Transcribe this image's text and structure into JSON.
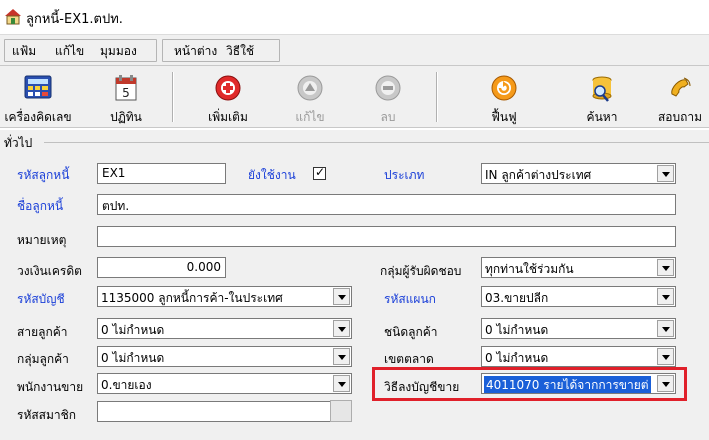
{
  "window": {
    "title": "ลูกหนี้-EX1.ตปท."
  },
  "menu": {
    "group1": [
      "แฟ้ม",
      "แก้ไข",
      "มุมมอง"
    ],
    "group2": [
      "หน้าต่าง",
      "วิธีใช้"
    ]
  },
  "toolbar": {
    "calculator": "เครื่องคิดเลข",
    "calendar": "ปฏิทิน",
    "calendar_day": "5",
    "add": "เพิ่มเติม",
    "edit": "แก้ไข",
    "delete": "ลบ",
    "restore": "ฟื้นฟู",
    "search": "ค้นหา",
    "inquiry": "สอบถาม"
  },
  "section": {
    "label": "ทั่วไป"
  },
  "form": {
    "customer_code_label": "รหัสลูกหนี้",
    "customer_code_value": "EX1",
    "active_label": "ยังใช้งาน",
    "active_mark": "✓",
    "type_label": "ประเภท",
    "type_value": "IN ลูกค้าต่างประเทศ",
    "customer_name_label": "ชื่อลูกหนี้",
    "customer_name_value": "ตปท.",
    "note_label": "หมายเหตุ",
    "note_value": "",
    "credit_limit_label": "วงเงินเครดิต",
    "credit_limit_value": "0.000",
    "responsible_group_label": "กลุ่มผู้รับผิดชอบ",
    "responsible_group_value": "ทุกท่านใช้ร่วมกัน",
    "account_code_label": "รหัสบัญชี",
    "account_code_value": "1135000 ลูกหนี้การค้า-ในประเทศ",
    "department_code_label": "รหัสแผนก",
    "department_code_value": "03.ขายปลีก",
    "customer_line_label": "สายลูกค้า",
    "customer_line_value": "0 ไม่กำหนด",
    "customer_kind_label": "ชนิดลูกค้า",
    "customer_kind_value": "0 ไม่กำหนด",
    "customer_group_label": "กลุ่มลูกค้า",
    "customer_group_value": "0 ไม่กำหนด",
    "market_zone_label": "เขตตลาด",
    "market_zone_value": "0 ไม่กำหนด",
    "salesperson_label": "พนักงานขาย",
    "salesperson_value": "0.ขายเอง",
    "sales_posting_label": "วิธีลงบัญชีขาย",
    "sales_posting_value": "4011070 รายได้จากการขายต่",
    "member_code_label": "รหัสสมาชิก",
    "member_code_value": ""
  },
  "colors": {
    "label_blue": "#1a3fd8",
    "highlight_red": "#e0202a",
    "selection_blue": "#1a5fd8"
  }
}
